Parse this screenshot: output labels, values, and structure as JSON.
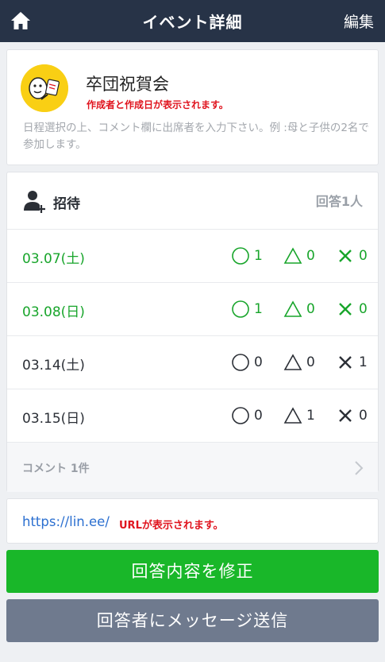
{
  "navbar": {
    "home_icon": "home-icon",
    "title": "イベント詳細",
    "edit_label": "編集"
  },
  "event": {
    "avatar_icon": "character-avatar",
    "title": "卒団祝賀会",
    "creator_note": "作成者と作成日が表示されます。",
    "description": "日程選択の上、コメント欄に出席者を入力下さい。例 :母と子供の2名で参加します。"
  },
  "invite": {
    "icon": "add-person-icon",
    "label": "招待",
    "answer_count": "回答1人"
  },
  "dates": [
    {
      "date": "03.07(土)",
      "ok": "1",
      "maybe": "0",
      "no": "0",
      "highlight": true
    },
    {
      "date": "03.08(日)",
      "ok": "1",
      "maybe": "0",
      "no": "0",
      "highlight": true
    },
    {
      "date": "03.14(土)",
      "ok": "0",
      "maybe": "0",
      "no": "1",
      "highlight": false
    },
    {
      "date": "03.15(日)",
      "ok": "0",
      "maybe": "1",
      "no": "0",
      "highlight": false
    }
  ],
  "comments": {
    "label": "コメント 1件",
    "chevron_icon": "chevron-right-icon"
  },
  "url_section": {
    "link": "https://lin.ee/",
    "note": "URLが表示されます。"
  },
  "buttons": {
    "edit_answer": "回答内容を修正",
    "message": "回答者にメッセージ送信"
  },
  "colors": {
    "navbar": "#273347",
    "green": "#18a52b",
    "button_green": "#19b729",
    "button_gray": "#6f7a8e",
    "note_red": "#e0141e",
    "link_blue": "#2b6fd0"
  }
}
